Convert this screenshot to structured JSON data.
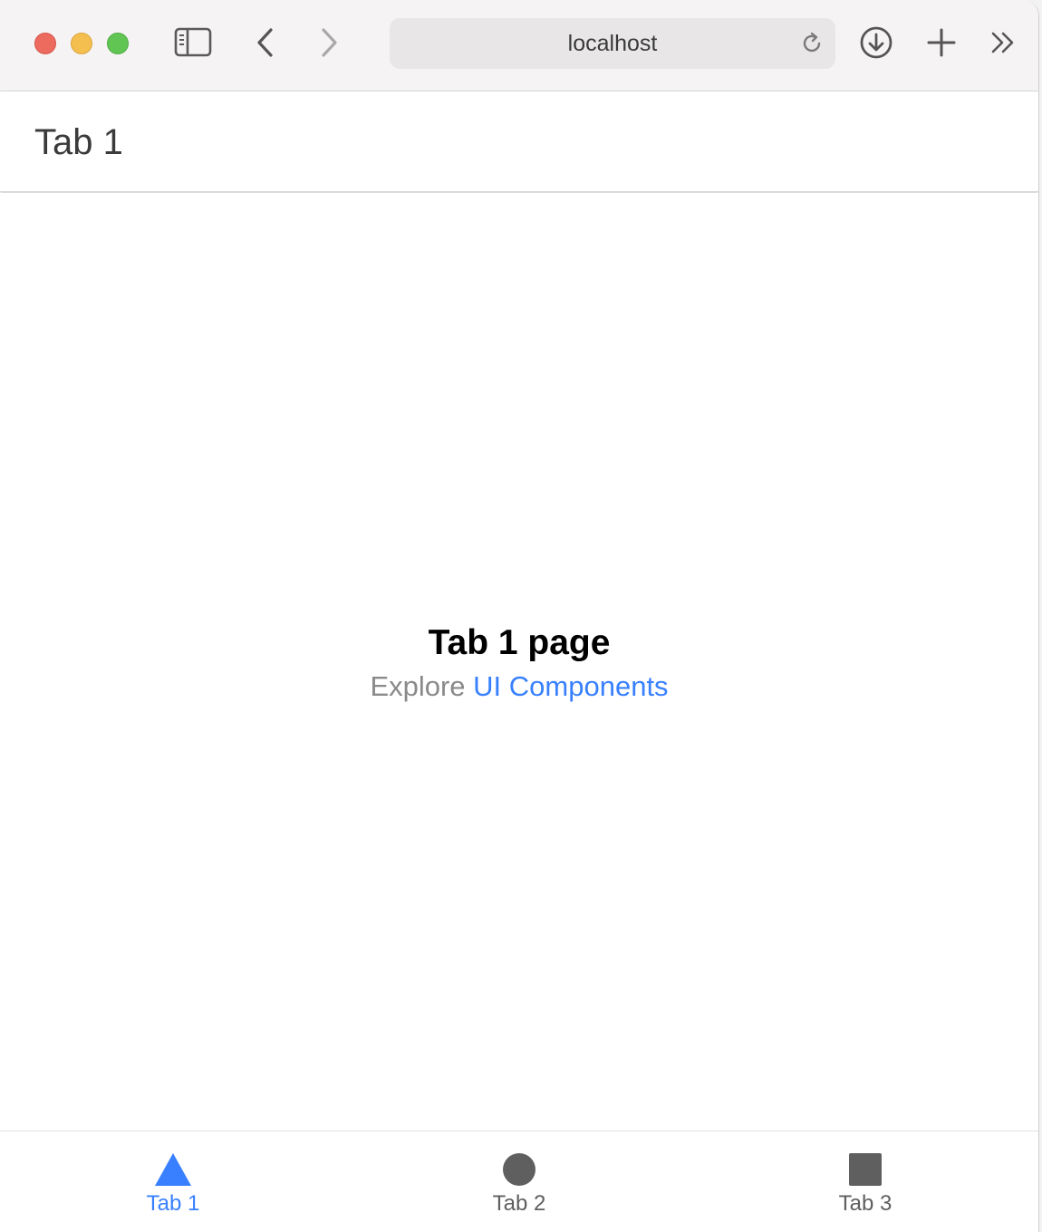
{
  "browser": {
    "address": "localhost"
  },
  "header": {
    "title": "Tab 1"
  },
  "main": {
    "heading": "Tab 1 page",
    "explore_text": "Explore",
    "explore_link": "UI Components"
  },
  "tabs": [
    {
      "label": "Tab 1",
      "icon": "triangle-icon",
      "selected": true
    },
    {
      "label": "Tab 2",
      "icon": "circle-icon",
      "selected": false
    },
    {
      "label": "Tab 3",
      "icon": "square-icon",
      "selected": false
    }
  ],
  "colors": {
    "accent": "#3880ff",
    "tab_inactive": "#5f5f5f",
    "traffic_red": "#ec6a5e",
    "traffic_yellow": "#f4bf4f",
    "traffic_green": "#61c554"
  }
}
